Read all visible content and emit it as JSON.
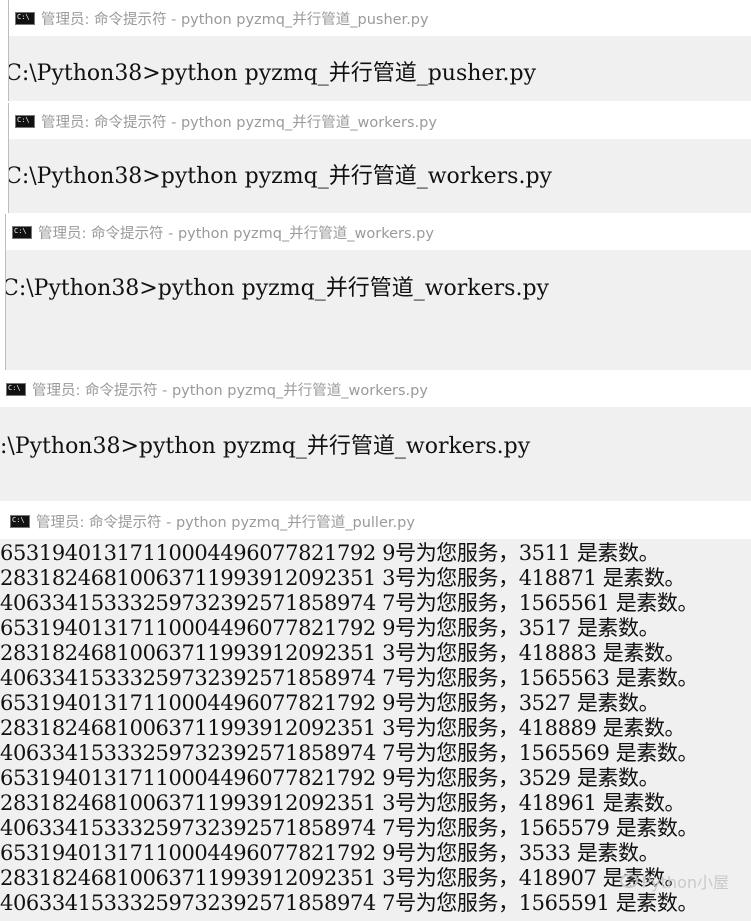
{
  "windows": [
    {
      "title": "管理员: 命令提示符 - python  pyzmq_并行管道_pusher.py",
      "command": "C:\\Python38>python pyzmq_并行管道_pusher.py"
    },
    {
      "title": "管理员: 命令提示符 - python  pyzmq_并行管道_workers.py",
      "command": "C:\\Python38>python pyzmq_并行管道_workers.py"
    },
    {
      "title": "管理员: 命令提示符 - python  pyzmq_并行管道_workers.py",
      "command": "C:\\Python38>python pyzmq_并行管道_workers.py"
    },
    {
      "title": "管理员: 命令提示符 - python  pyzmq_并行管道_workers.py",
      "command": ":\\Python38>python pyzmq_并行管道_workers.py"
    }
  ],
  "puller": {
    "title": "管理员: 命令提示符 - python  pyzmq_并行管道_puller.py",
    "lines": [
      "65319401317110004496077821792 9号为您服务，3511 是素数。",
      "28318246810063711993912092351 3号为您服务，418871 是素数。",
      "40633415333259732392571858974 7号为您服务，1565561 是素数。",
      "65319401317110004496077821792 9号为您服务，3517 是素数。",
      "28318246810063711993912092351 3号为您服务，418883 是素数。",
      "40633415333259732392571858974 7号为您服务，1565563 是素数。",
      "65319401317110004496077821792 9号为您服务，3527 是素数。",
      "28318246810063711993912092351 3号为您服务，418889 是素数。",
      "40633415333259732392571858974 7号为您服务，1565569 是素数。",
      "65319401317110004496077821792 9号为您服务，3529 是素数。",
      "28318246810063711993912092351 3号为您服务，418961 是素数。",
      "40633415333259732392571858974 7号为您服务，1565579 是素数。",
      "65319401317110004496077821792 9号为您服务，3533 是素数。",
      "28318246810063711993912092351 3号为您服务，418907 是素数。",
      "40633415333259732392571858974 7号为您服务，1565591 是素数。"
    ]
  },
  "watermark": "Python小屋"
}
